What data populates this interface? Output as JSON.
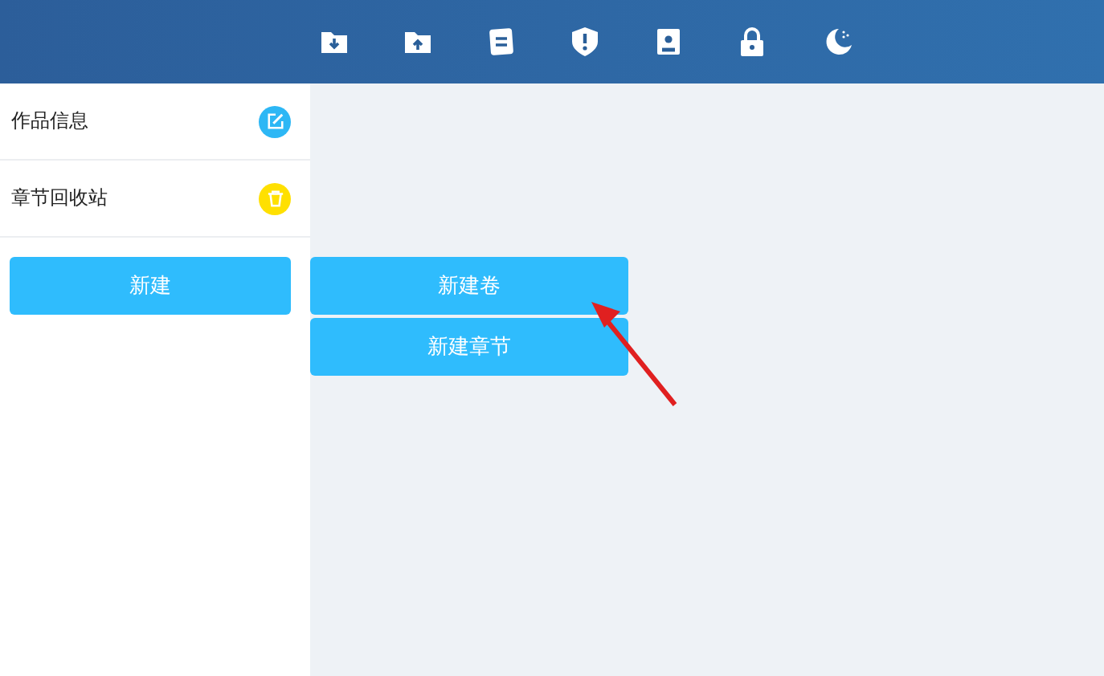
{
  "toolbar": {
    "icons": [
      {
        "kind": "folder-down"
      },
      {
        "kind": "folder-up"
      },
      {
        "kind": "note"
      },
      {
        "kind": "shield"
      },
      {
        "kind": "contact"
      },
      {
        "kind": "lock"
      },
      {
        "kind": "moon"
      }
    ]
  },
  "sidebar": {
    "items": [
      {
        "label": "作品信息",
        "kind": "edit",
        "color": "#2db7f5"
      },
      {
        "label": "章节回收站",
        "kind": "trash",
        "color": "#ffe000"
      }
    ],
    "button": "新建"
  },
  "menu": {
    "items": [
      "新建卷",
      "新建章节"
    ]
  }
}
